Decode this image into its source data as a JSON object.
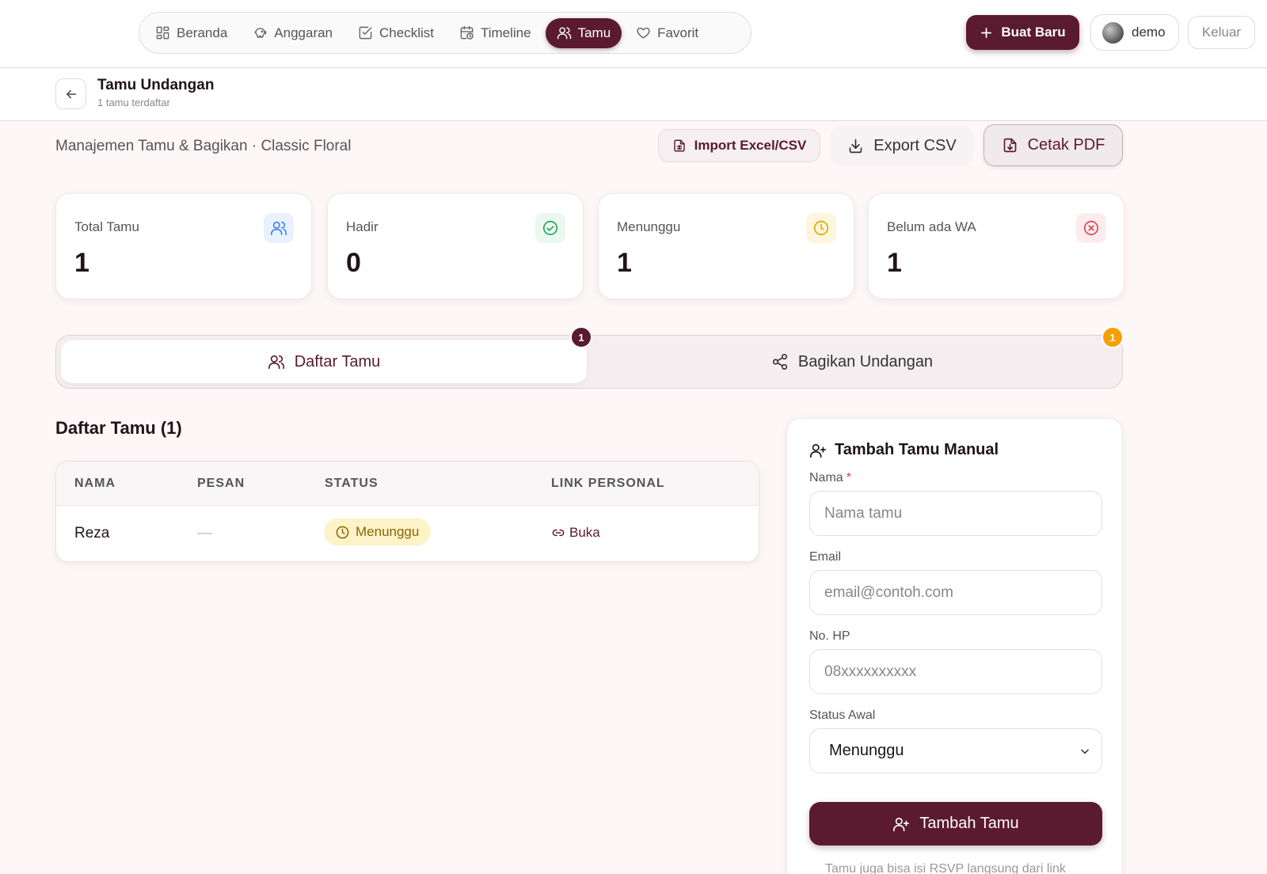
{
  "nav": {
    "items": [
      {
        "label": "Beranda",
        "icon": "dashboard-icon"
      },
      {
        "label": "Anggaran",
        "icon": "piggy-bank-icon"
      },
      {
        "label": "Checklist",
        "icon": "checkbox-icon"
      },
      {
        "label": "Timeline",
        "icon": "calendar-clock-icon"
      },
      {
        "label": "Tamu",
        "icon": "users-icon",
        "active": true
      },
      {
        "label": "Favorit",
        "icon": "heart-icon"
      }
    ],
    "new_button": "Buat Baru",
    "user_name": "demo",
    "logout": "Keluar"
  },
  "header": {
    "title": "Tamu Undangan",
    "subtitle": "1 tamu terdaftar"
  },
  "toolbar": {
    "subtitle": "Manajemen Tamu & Bagikan · Classic Floral",
    "import_label": "Import Excel/CSV",
    "export_label": "Export CSV",
    "pdf_label": "Cetak PDF"
  },
  "stats": [
    {
      "label": "Total Tamu",
      "value": "1",
      "icon": "users-icon",
      "color": "#3b82f6",
      "bg": "#eaf1fe"
    },
    {
      "label": "Hadir",
      "value": "0",
      "icon": "check-circle-icon",
      "color": "#22a55b",
      "bg": "#eaf8ef"
    },
    {
      "label": "Menunggu",
      "value": "1",
      "icon": "clock-icon",
      "color": "#e0a800",
      "bg": "#fdf6dc"
    },
    {
      "label": "Belum ada WA",
      "value": "1",
      "icon": "x-circle-icon",
      "color": "#e0454f",
      "bg": "#fdecee"
    }
  ],
  "tabs": {
    "guests_label": "Daftar Tamu",
    "guests_badge": "1",
    "share_label": "Bagikan Undangan",
    "share_badge": "1"
  },
  "guest_list": {
    "title": "Daftar Tamu (1)",
    "columns": [
      "NAMA",
      "PESAN",
      "STATUS",
      "LINK PERSONAL"
    ],
    "rows": [
      {
        "name": "Reza",
        "message": "—",
        "status": "Menunggu",
        "link": "Buka"
      }
    ]
  },
  "form": {
    "title": "Tambah Tamu Manual",
    "name_label": "Nama",
    "required_mark": "*",
    "name_placeholder": "Nama tamu",
    "email_label": "Email",
    "email_placeholder": "email@contoh.com",
    "phone_label": "No. HP",
    "phone_placeholder": "08xxxxxxxxxx",
    "status_label": "Status Awal",
    "status_value": "Menunggu",
    "submit_label": "Tambah Tamu",
    "hint": "Tamu juga bisa isi RSVP langsung dari link"
  },
  "colors": {
    "brand": "#5a1a30",
    "pending_bg": "#fdf3c9",
    "share_badge": "#f5a000"
  }
}
